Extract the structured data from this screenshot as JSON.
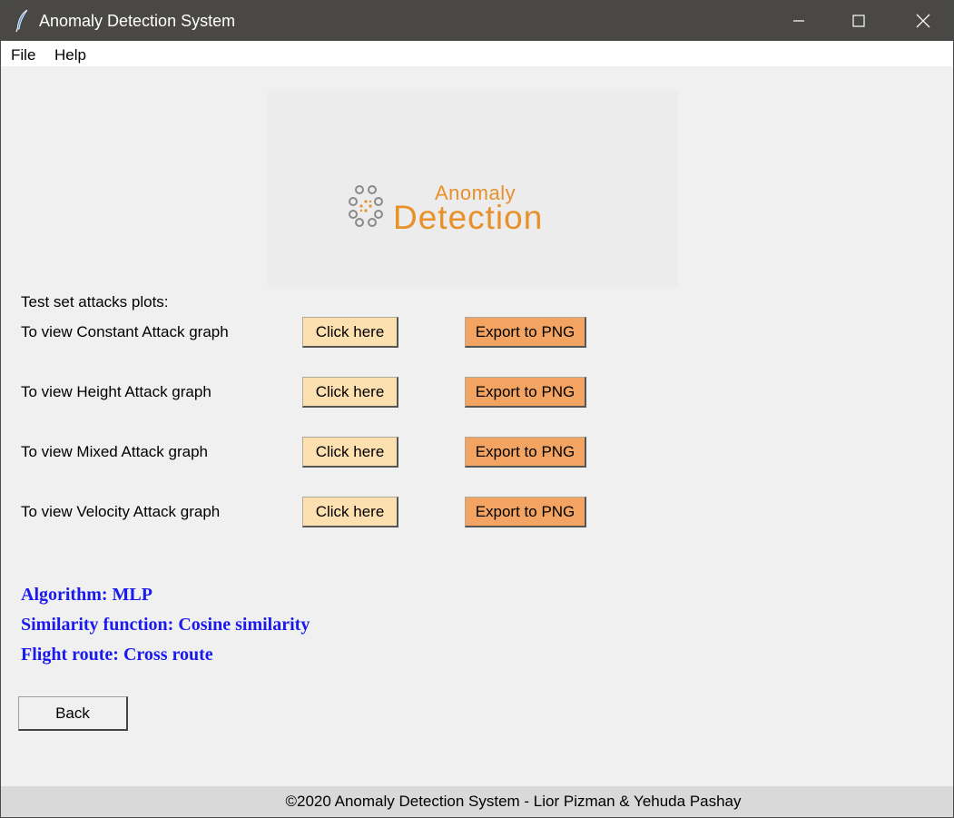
{
  "window": {
    "title": "Anomaly Detection System",
    "icon": "feather-icon"
  },
  "menu": {
    "file": "File",
    "help": "Help"
  },
  "logo": {
    "small_text": "Anomaly",
    "big_text": "Detection",
    "color": "#e8902a"
  },
  "section_title": "Test set attacks plots:",
  "attacks": [
    {
      "label": "To view Constant Attack graph",
      "view": "Click here",
      "export": "Export to PNG"
    },
    {
      "label": "To view Height Attack graph",
      "view": "Click here",
      "export": "Export to PNG"
    },
    {
      "label": "To view Mixed Attack graph",
      "view": "Click here",
      "export": "Export to PNG"
    },
    {
      "label": "To view Velocity Attack graph",
      "view": "Click here",
      "export": "Export to PNG"
    }
  ],
  "info": {
    "algorithm": "Algorithm: MLP",
    "similarity": "Similarity function: Cosine similarity",
    "route": "Flight route: Cross route"
  },
  "back_label": "Back",
  "footer": "©2020 Anomaly Detection System - Lior Pizman & Yehuda Pashay",
  "colors": {
    "view_button": "#fde0b0",
    "export_button": "#f4a462",
    "info_text": "#1a1aee",
    "titlebar": "#4a4845"
  }
}
